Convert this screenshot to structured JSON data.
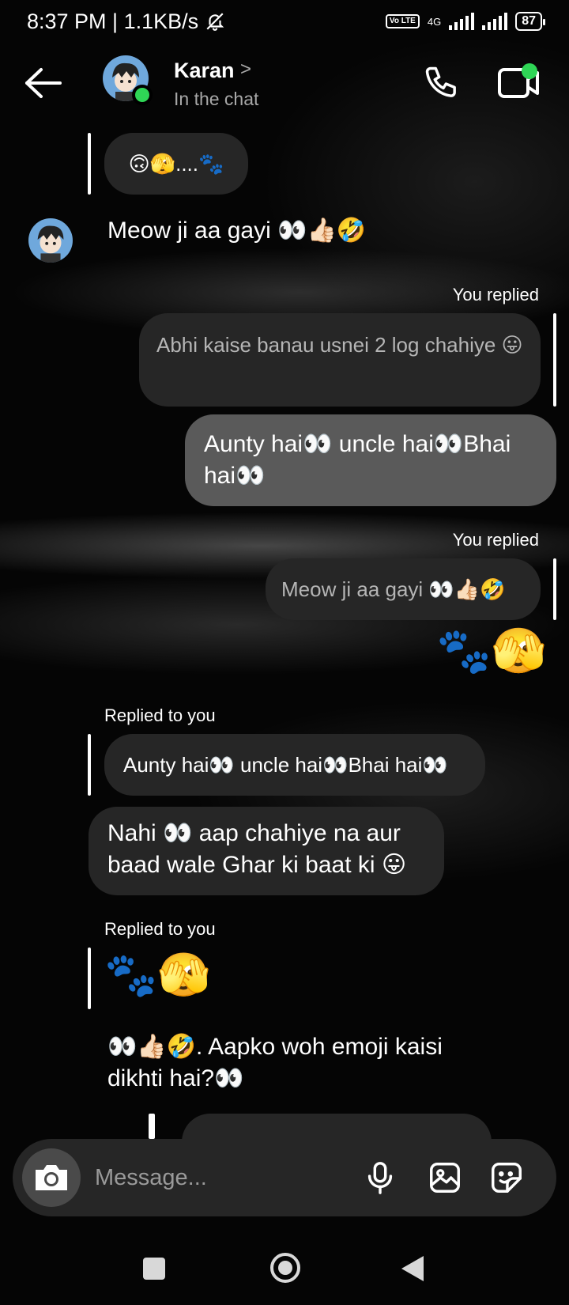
{
  "status_bar": {
    "time_speed": "8:37 PM | 1.1KB/s",
    "volte": "Vo LTE",
    "network": "4G",
    "battery": "87"
  },
  "header": {
    "contact_name": "Karan",
    "contact_status": "In the chat",
    "chevron": ">"
  },
  "messages": {
    "m1_quote": "🙃🫣....🐾",
    "m2_text": "Meow ji aa gayi 👀👍🏻🤣",
    "m3_label": "You replied",
    "m3_quote": "Abhi kaise banau usnei 2 log chahiye 😛",
    "m4_text": "Aunty hai👀 uncle hai👀Bhai hai👀",
    "m5_label": "You replied",
    "m5_quote": "Meow ji aa gayi 👀👍🏻🤣",
    "m6_emoji": "🐾🫣",
    "m7_label": "Replied to you",
    "m7_quote": "Aunty hai👀 uncle hai👀Bhai hai👀",
    "m8_text": "Nahi 👀 aap chahiye na aur baad wale Ghar ki baat ki 😛",
    "m9_label": "Replied to you",
    "m9_quote": "🐾🫣",
    "m10_text": "👀👍🏻🤣. Aapko woh emoji kaisi dikhti hai?👀"
  },
  "composer": {
    "placeholder": "Message..."
  },
  "colors": {
    "online": "#2fd656",
    "bubble": "#262626",
    "sent_bubble": "#5a5a5a"
  }
}
